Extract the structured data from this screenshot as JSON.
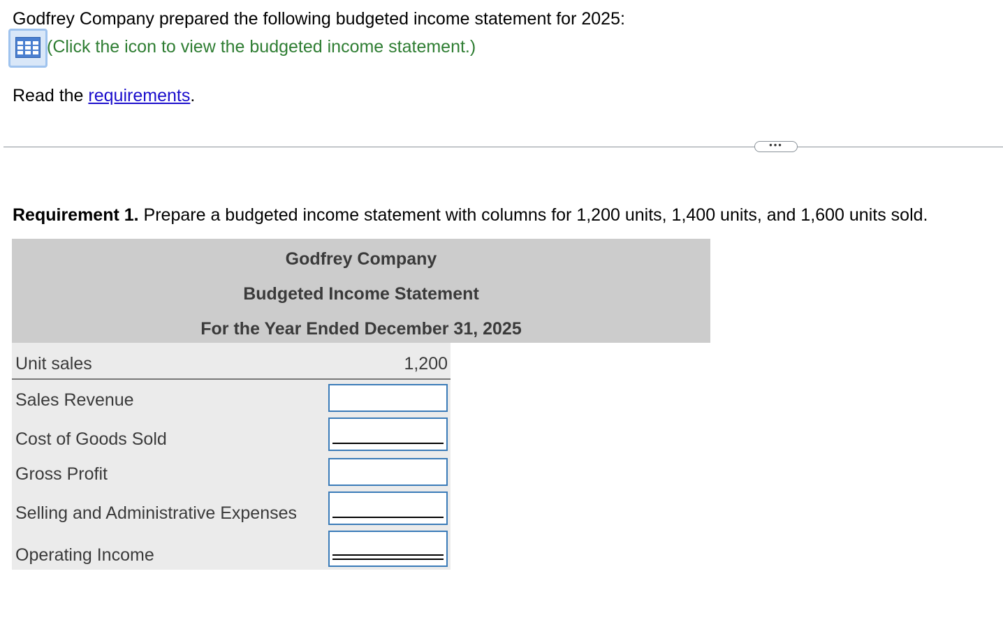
{
  "intro": {
    "statement": "Godfrey Company prepared the following budgeted income statement for 2025:",
    "icon_link_text": "(Click the icon to view the budgeted income statement.)",
    "icon": "table-grid-icon",
    "read_prefix": "Read the ",
    "read_link": "requirements",
    "read_suffix": "."
  },
  "divider": {
    "more_label": "•••"
  },
  "requirement": {
    "label": "Requirement 1.",
    "text": " Prepare a budgeted income statement with columns for 1,200 units, 1,400 units, and 1,600 units sold."
  },
  "statement": {
    "company": "Godfrey Company",
    "title": "Budgeted Income Statement",
    "period": "For the Year Ended December 31, 2025",
    "units_label": "Unit sales",
    "units_value": "1,200",
    "rows": [
      {
        "label": "Sales Revenue",
        "value": ""
      },
      {
        "label": "Cost of Goods Sold",
        "value": ""
      },
      {
        "label": "Gross Profit",
        "value": ""
      },
      {
        "label": "Selling and Administrative Expenses",
        "value": ""
      },
      {
        "label": "Operating Income",
        "value": ""
      }
    ]
  },
  "colors": {
    "link_blue": "#1a0dcc",
    "icon_link_green": "#2e7d32",
    "header_band": "#cccccc",
    "body_band": "#ebebeb",
    "input_border": "#3a7bb8"
  }
}
